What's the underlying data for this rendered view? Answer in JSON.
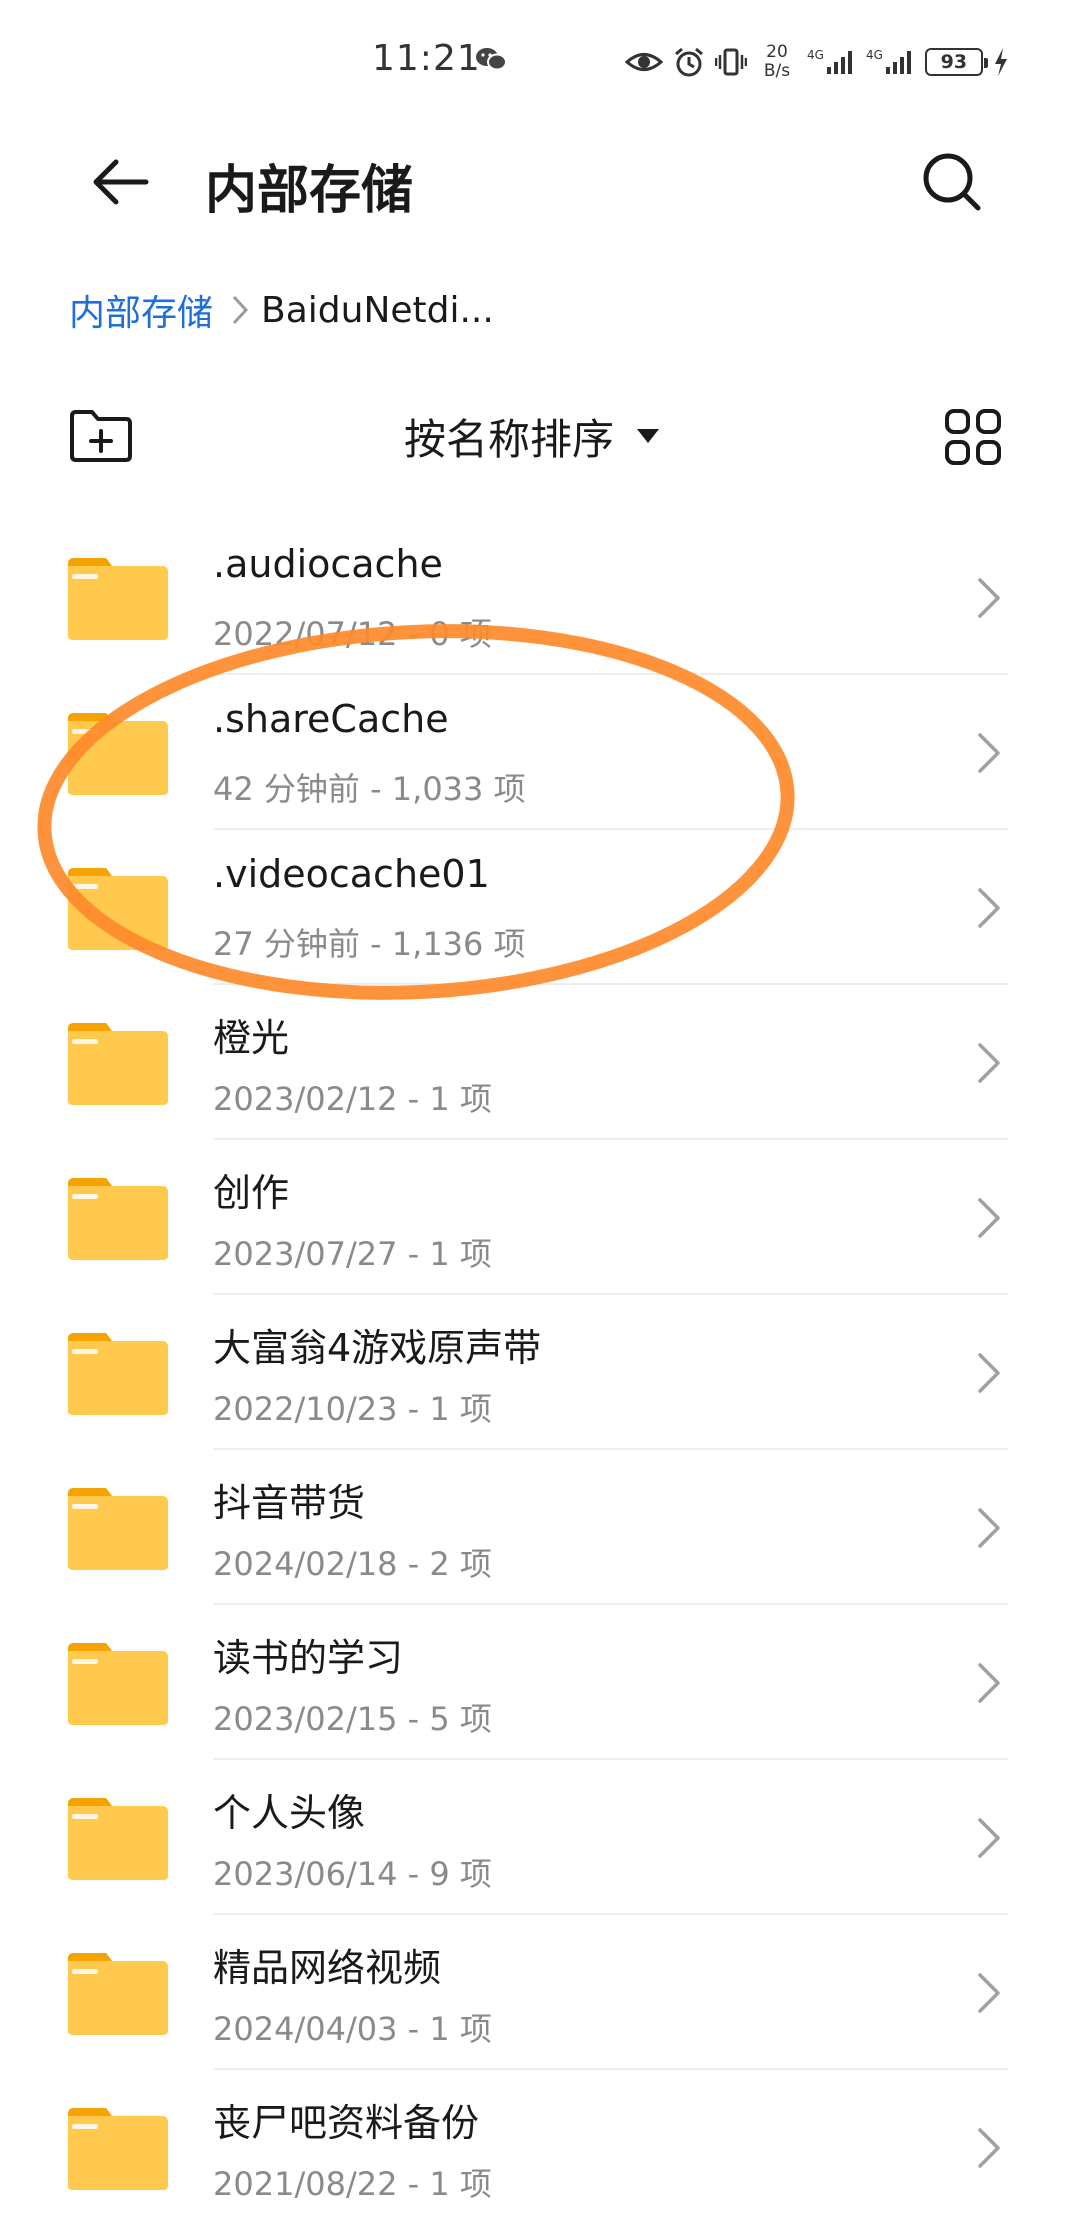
{
  "status_bar": {
    "time": "11:21",
    "net_speed_value": "20",
    "net_speed_unit": "B/s",
    "network_1": "4G",
    "network_2": "4G",
    "battery": "93",
    "icons": [
      "wechat-icon",
      "eye-icon",
      "alarm-icon",
      "vibrate-icon",
      "signal-icon",
      "signal-icon",
      "charging-icon"
    ]
  },
  "header": {
    "title": "内部存储",
    "back_icon": "arrow-left-icon",
    "search_icon": "search-icon"
  },
  "breadcrumb": {
    "root": "内部存储",
    "current": "BaiduNetdi..."
  },
  "toolbar": {
    "sort_label": "按名称排序",
    "new_folder_icon": "new-folder-icon",
    "view_icon": "grid-view-icon"
  },
  "colors": {
    "accent": "#1e6fd9",
    "folder": "#ffc94d",
    "folder_tab": "#f5a300",
    "highlight_ring": "#ff8a2b"
  },
  "files": [
    {
      "name": ".audiocache",
      "meta": "2022/07/12 - 0 项"
    },
    {
      "name": ".shareCache",
      "meta": "42 分钟前 - 1,033 项"
    },
    {
      "name": ".videocache01",
      "meta": "27 分钟前 - 1,136 项"
    },
    {
      "name": "橙光",
      "meta": "2023/02/12 - 1 项"
    },
    {
      "name": "创作",
      "meta": "2023/07/27 - 1 项"
    },
    {
      "name": "大富翁4游戏原声带",
      "meta": "2022/10/23 - 1 项"
    },
    {
      "name": "抖音带货",
      "meta": "2024/02/18 - 2 项"
    },
    {
      "name": "读书的学习",
      "meta": "2023/02/15 - 5 项"
    },
    {
      "name": "个人头像",
      "meta": "2023/06/14 - 9 项"
    },
    {
      "name": "精品网络视频",
      "meta": "2024/04/03 - 1 项"
    },
    {
      "name": "丧尸吧资料备份",
      "meta": "2021/08/22 - 1 项"
    }
  ]
}
